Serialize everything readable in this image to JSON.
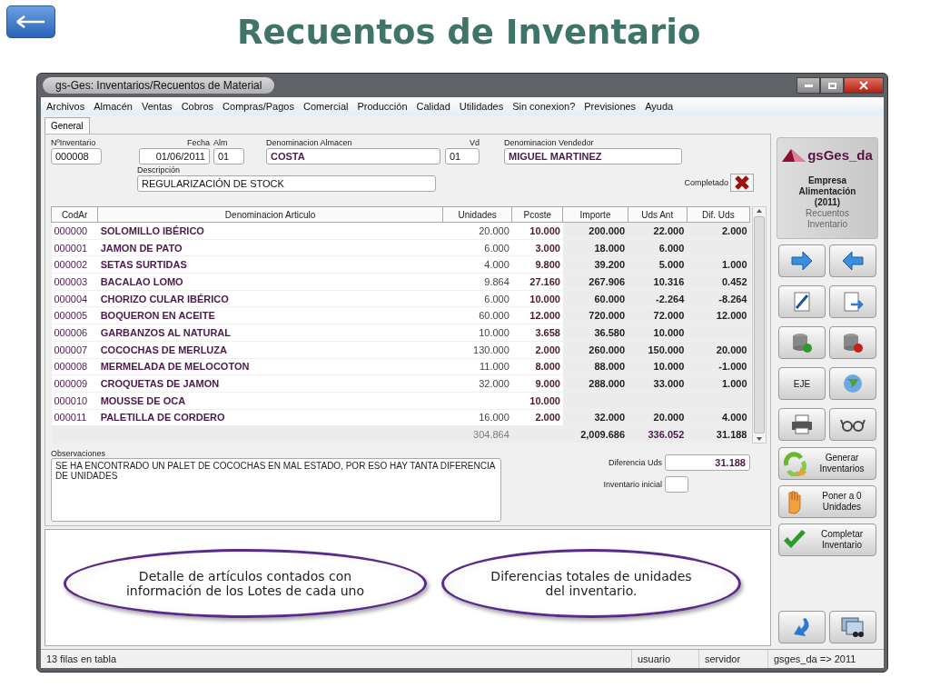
{
  "slide": {
    "title": "Recuentos de Inventario"
  },
  "window": {
    "title": "gs-Ges: Inventarios/Recuentos de Material"
  },
  "menu": [
    "Archivos",
    "Almacén",
    "Ventas",
    "Cobros",
    "Compras/Pagos",
    "Comercial",
    "Producción",
    "Calidad",
    "Utilidades",
    "Sin conexion?",
    "Previsiones",
    "Ayuda"
  ],
  "tabs": [
    {
      "label": "General",
      "selected": true
    }
  ],
  "form": {
    "fields": [
      {
        "label": "NºInventario",
        "value": "000008"
      },
      {
        "label": "Fecha",
        "value": "01/06/2011"
      },
      {
        "label": "Alm",
        "value": "01"
      },
      {
        "label": "Denominacion Almacen",
        "value": "COSTA"
      },
      {
        "label": "Vd",
        "value": "01"
      },
      {
        "label": "Denominacion Vendedor",
        "value": "MIGUEL MARTINEZ"
      },
      {
        "label": "Descripción",
        "value": "REGULARIZACIÓN DE STOCK"
      }
    ],
    "completed": {
      "label": "Completado",
      "checked": false
    }
  },
  "table": {
    "columns": [
      "CodAr",
      "Denominacion Articulo",
      "Unidades",
      "Pcoste",
      "Importe",
      "Uds Ant",
      "Dif. Uds"
    ],
    "rows": [
      {
        "code": "000000",
        "name": "SOLOMILLO IBÉRICO",
        "units": "20.000",
        "cost": "10.000",
        "amount": "200.000",
        "prev": "22.000",
        "diff": "2.000"
      },
      {
        "code": "000001",
        "name": "JAMON DE PATO",
        "units": "6.000",
        "cost": "3.000",
        "amount": "18.000",
        "prev": "6.000"
      },
      {
        "code": "000002",
        "name": "SETAS SURTIDAS",
        "units": "4.000",
        "cost": "9.800",
        "amount": "39.200",
        "prev": "5.000",
        "diff": "1.000"
      },
      {
        "code": "000003",
        "name": "BACALAO LOMO",
        "units": "9.864",
        "cost": "27.160",
        "amount": "267.906",
        "prev": "10.316",
        "diff": "0.452"
      },
      {
        "code": "000004",
        "name": "CHORIZO CULAR IBÉRICO",
        "units": "6.000",
        "cost": "10.000",
        "amount": "60.000",
        "prev": "-2.264",
        "diff": "-8.264"
      },
      {
        "code": "000005",
        "name": "BOQUERON EN ACEITE",
        "units": "60.000",
        "cost": "12.000",
        "amount": "720.000",
        "prev": "72.000",
        "diff": "12.000"
      },
      {
        "code": "000006",
        "name": "GARBANZOS AL NATURAL",
        "units": "10.000",
        "cost": "3.658",
        "amount": "36.580",
        "prev": "10.000"
      },
      {
        "code": "000007",
        "name": "COCOCHAS DE MERLUZA",
        "units": "130.000",
        "cost": "2.000",
        "amount": "260.000",
        "prev": "150.000",
        "diff": "20.000"
      },
      {
        "code": "000008",
        "name": "MERMELADA DE MELOCOTON",
        "units": "11.000",
        "cost": "8.000",
        "amount": "88.000",
        "prev": "10.000",
        "diff": "-1.000"
      },
      {
        "code": "000009",
        "name": "CROQUETAS DE JAMON",
        "units": "32.000",
        "cost": "9.000",
        "amount": "288.000",
        "prev": "33.000",
        "diff": "1.000"
      },
      {
        "code": "000010",
        "name": "MOUSSE DE OCA",
        "cost": "10.000"
      },
      {
        "code": "000011",
        "name": "PALETILLA DE CORDERO",
        "units": "16.000",
        "cost": "2.000",
        "amount": "32.000",
        "prev": "20.000",
        "diff": "4.000"
      }
    ],
    "totals": {
      "units": "304.864",
      "amount": "2,009.686",
      "prev": "336.052",
      "diff": "31.188"
    }
  },
  "observations": {
    "label": "Observaciones",
    "value": "SE HA ENCONTRADO UN PALET DE COCOCHAS EN MAL ESTADO, POR ESO HAY TANTA DIFERENCIA DE UNIDADES"
  },
  "summary": [
    {
      "label": "Diferencia Uds",
      "value": "31.188"
    },
    {
      "label": "Inventario inicial"
    }
  ],
  "logo": {
    "name": "gsGes_da",
    "lines": [
      "Empresa",
      "Alimentación",
      "(2011)"
    ],
    "subtitle": [
      "Recuentos",
      "Inventario"
    ]
  },
  "sidebar": {
    "text_button": "EJE",
    "actions": [
      "Generar Inventarios",
      "Poner a 0 Unidades",
      "Completar Inventario"
    ]
  },
  "callouts": [
    "Detalle de artículos contados con información de los  Lotes de cada uno",
    "Diferencias totales de unidades del inventario."
  ],
  "status_bar": [
    "13 filas en tabla",
    "usuario",
    "servidor",
    "gsges_da => 2011"
  ]
}
